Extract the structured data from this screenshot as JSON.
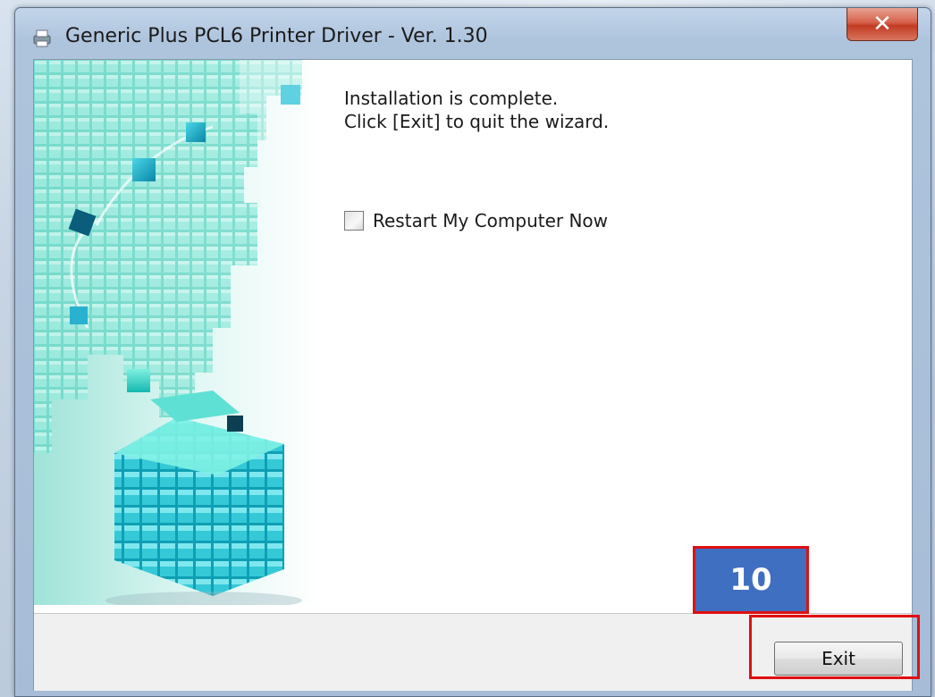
{
  "window": {
    "title": "Generic Plus PCL6 Printer Driver - Ver. 1.30",
    "close_glyph": "✕"
  },
  "content": {
    "message_line1": "Installation is complete.",
    "message_line2": "Click [Exit] to quit the wizard.",
    "restart_checkbox": {
      "label": "Restart My Computer Now",
      "checked": false
    }
  },
  "footer": {
    "exit_label": "Exit"
  },
  "annotation": {
    "step_number": "10",
    "badge_color": "#3f6fc0",
    "highlight_color": "#e01010"
  },
  "icons": {
    "app": "printer-icon",
    "close": "close-icon"
  }
}
